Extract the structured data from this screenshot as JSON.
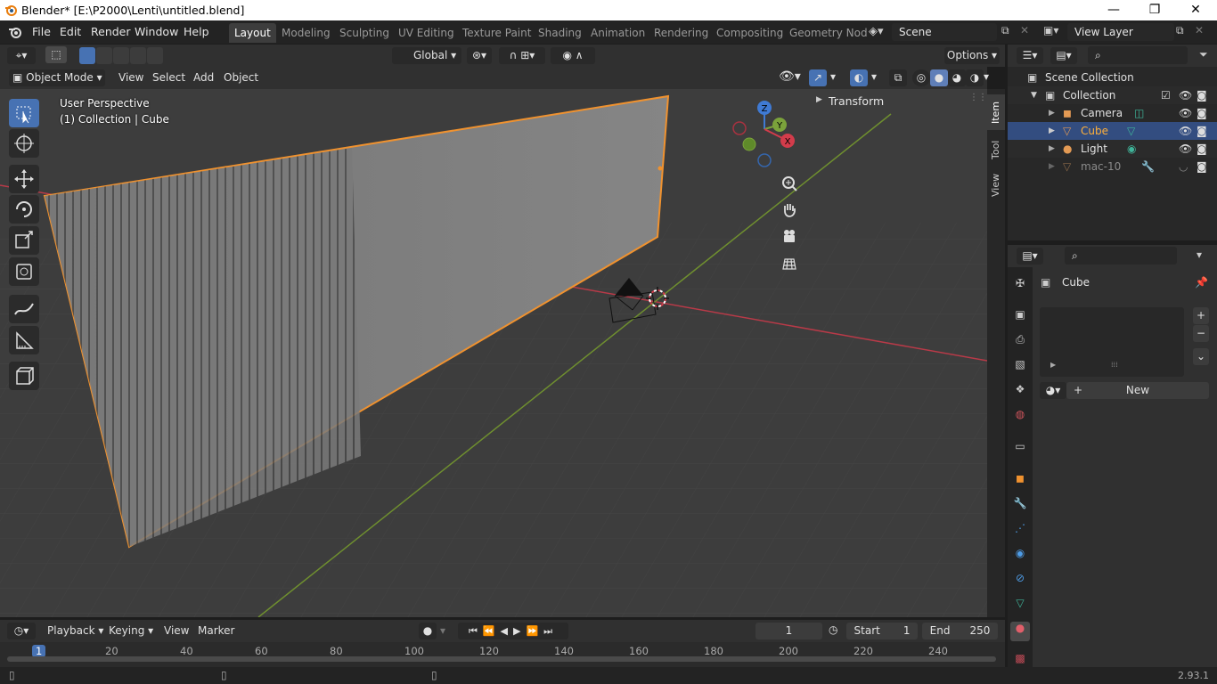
{
  "window": {
    "title": "Blender* [E:\\P2000\\Lenti\\untitled.blend]",
    "minimize": "—",
    "restore": "❐",
    "close": "✕"
  },
  "menu": {
    "file": "File",
    "edit": "Edit",
    "render": "Render",
    "window": "Window",
    "help": "Help"
  },
  "workspaces": [
    "Layout",
    "Modeling",
    "Sculpting",
    "UV Editing",
    "Texture Paint",
    "Shading",
    "Animation",
    "Rendering",
    "Compositing",
    "Geometry Nod"
  ],
  "scene": {
    "name": "Scene",
    "view_layer": "View Layer"
  },
  "toolheader": {
    "transform_orientation": "Global",
    "options": "Options"
  },
  "viewport_header": {
    "mode": "Object Mode",
    "view": "View",
    "select": "Select",
    "add": "Add",
    "object": "Object"
  },
  "viewport": {
    "perspective": "User Perspective",
    "context": "(1) Collection | Cube",
    "transform_panel": "Transform"
  },
  "gizmo": {
    "z": "Z",
    "y": "Y",
    "x": "X"
  },
  "sidebar_tabs": [
    "Item",
    "Tool",
    "View"
  ],
  "outliner": {
    "root": "Scene Collection",
    "collection": "Collection",
    "items": [
      {
        "name": "Camera",
        "icon": "camera-icon"
      },
      {
        "name": "Cube",
        "icon": "mesh-icon"
      },
      {
        "name": "Light",
        "icon": "light-icon"
      },
      {
        "name": "mac-10",
        "icon": "mesh-icon"
      }
    ]
  },
  "properties": {
    "object_name": "Cube",
    "new_button": "New",
    "plus": "+",
    "minus": "−"
  },
  "timeline": {
    "playback": "Playback",
    "keying": "Keying",
    "view": "View",
    "marker": "Marker",
    "current_frame": "1",
    "start_label": "Start",
    "start": "1",
    "end_label": "End",
    "end": "250",
    "ruler": [
      "1",
      "20",
      "40",
      "60",
      "80",
      "100",
      "120",
      "140",
      "160",
      "180",
      "200",
      "220",
      "240"
    ]
  },
  "status": {
    "version": "2.93.1"
  },
  "colors": {
    "accent": "#4772b3",
    "selection_outline": "#f0922f",
    "x_axis": "#d23c4b",
    "y_axis": "#7ba23b",
    "z_axis": "#3f7ad4"
  }
}
